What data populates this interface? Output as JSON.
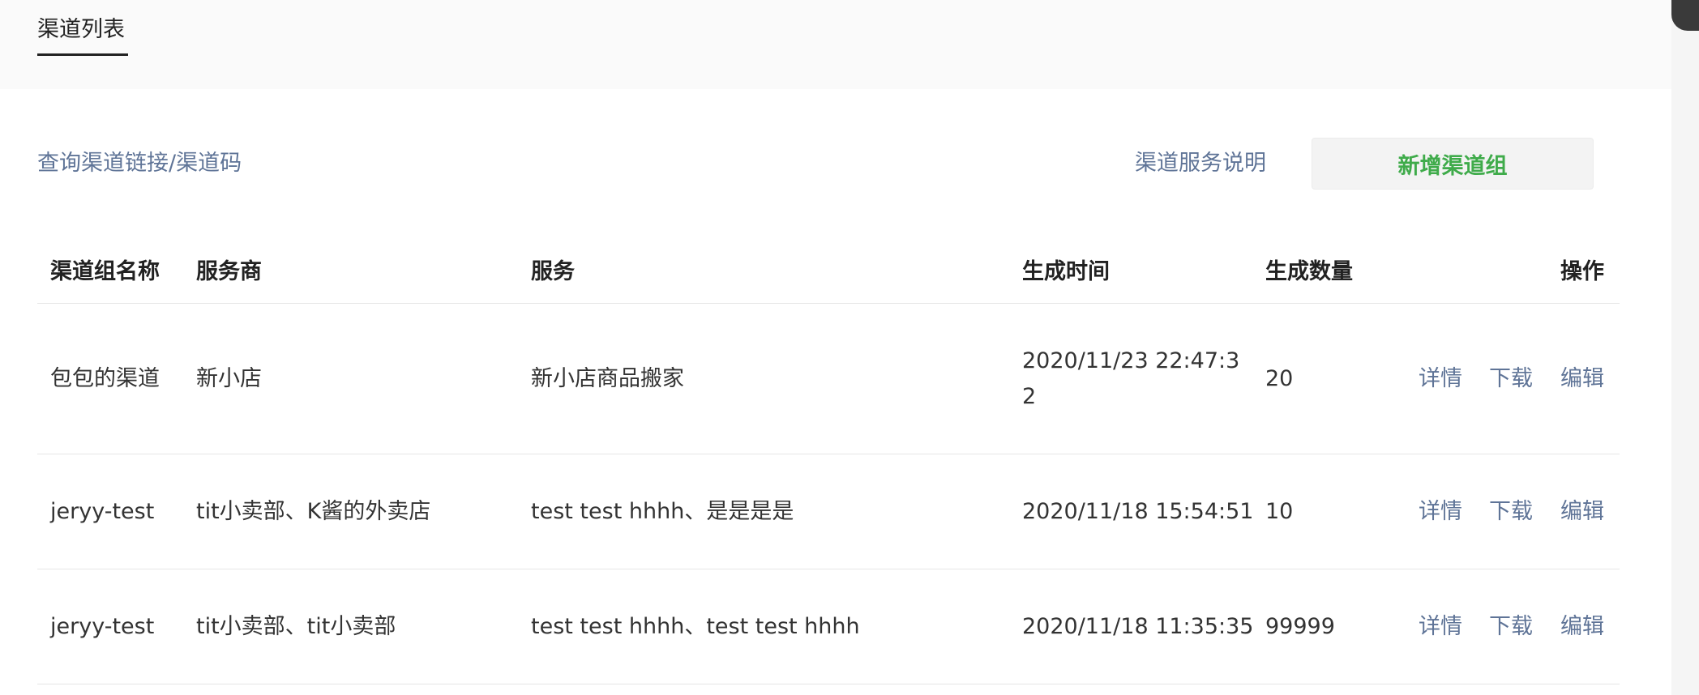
{
  "tabs": {
    "active_label": "渠道列表"
  },
  "toolbar": {
    "query_link": "查询渠道链接/渠道码",
    "service_link": "渠道服务说明",
    "add_button": "新增渠道组"
  },
  "table": {
    "columns": [
      "渠道组名称",
      "服务商",
      "服务",
      "生成时间",
      "生成数量",
      "操作"
    ],
    "rows": [
      {
        "name": "包包的渠道",
        "provider": "新小店",
        "service": "新小店商品搬家",
        "time": "2020/11/23 22:47:32",
        "count": "20",
        "actions": [
          "详情",
          "下载",
          "编辑"
        ]
      },
      {
        "name": "jeryy-test",
        "provider": "tit小卖部、K酱的外卖店",
        "service": "test test hhhh、是是是是",
        "time": "2020/11/18 15:54:51",
        "count": "10",
        "actions": [
          "详情",
          "下载",
          "编辑"
        ]
      },
      {
        "name": "jeryy-test",
        "provider": "tit小卖部、tit小卖部",
        "service": "test test hhhh、test test hhhh",
        "time": "2020/11/18 11:35:35",
        "count": "99999",
        "actions": [
          "详情",
          "下载",
          "编辑"
        ]
      }
    ]
  },
  "colors": {
    "link": "#5f7497",
    "primary_green": "#3fab4a",
    "tab_bar_bg": "#fafafa",
    "border": "#e6e6e6"
  }
}
